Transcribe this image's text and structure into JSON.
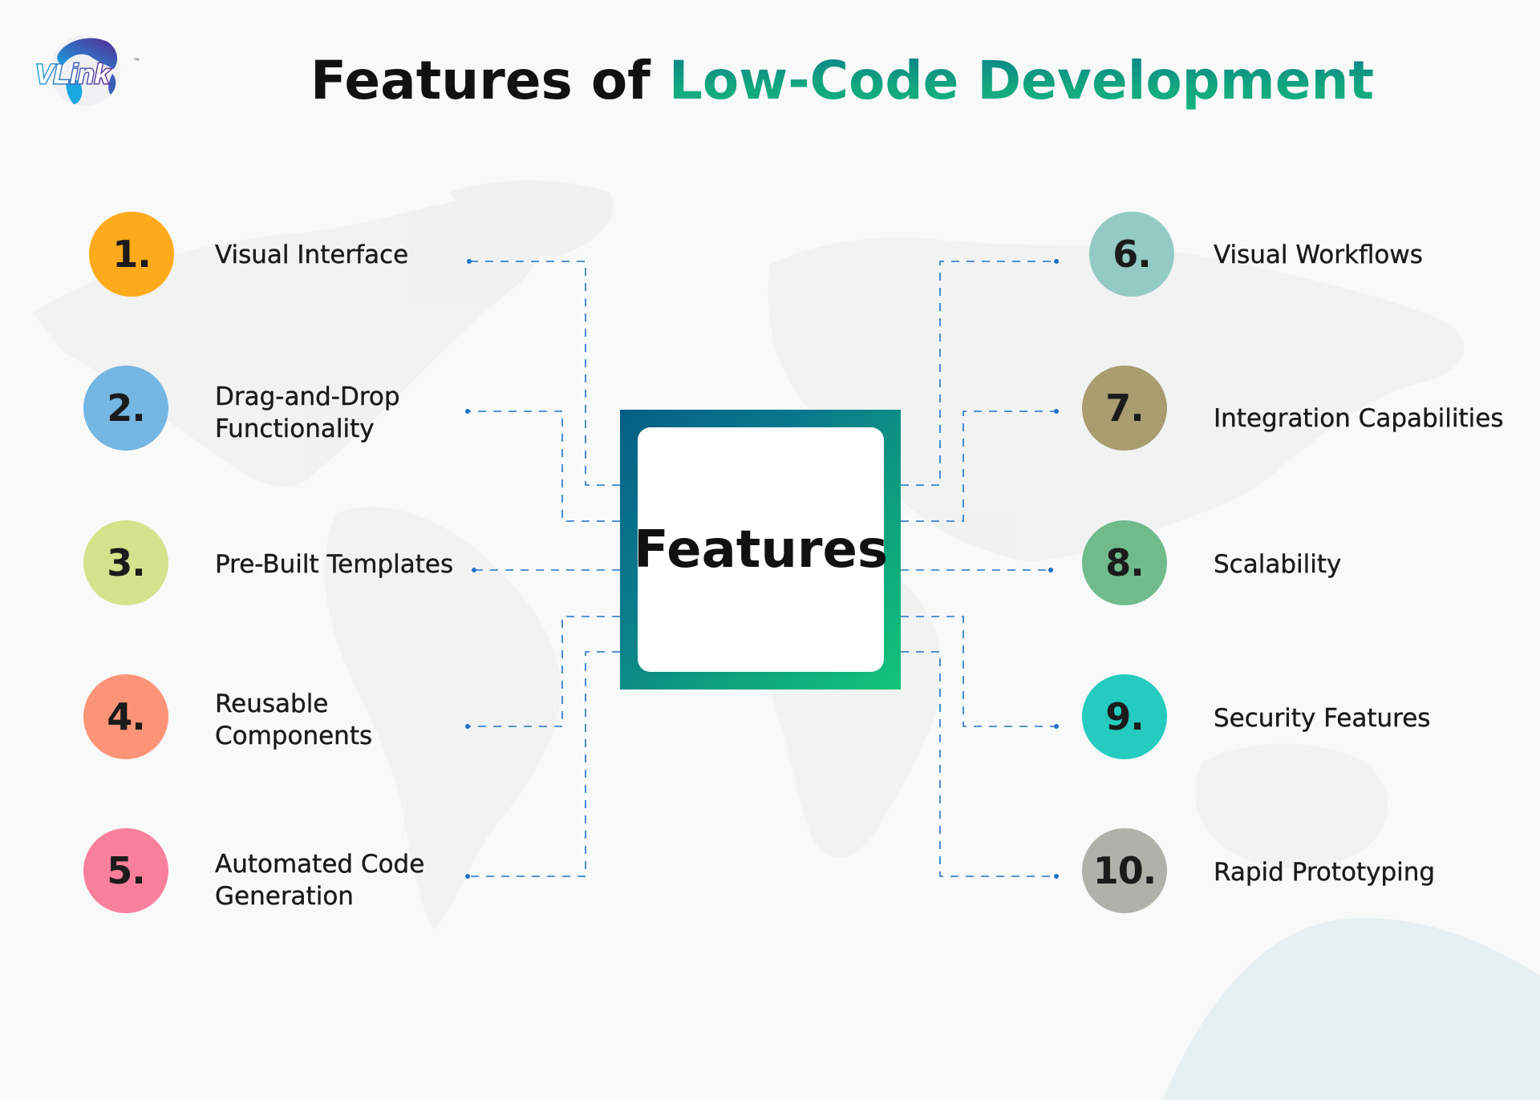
{
  "brand": {
    "logo_text": "VLink",
    "trademark": "™",
    "logo_icon": "globe-icon"
  },
  "header": {
    "title_plain": "Features of ",
    "title_accent": "Low-Code Development",
    "accent_color": "#13a77e"
  },
  "center": {
    "label": "Features",
    "gradient_start": "#055e86",
    "gradient_end": "#13c47a"
  },
  "connector_color": "#1f72c9",
  "features": [
    {
      "number": "1.",
      "label": "Visual Interface",
      "color": "#fdab1b",
      "side": "left"
    },
    {
      "number": "2.",
      "label": "Drag-and-Drop Functionality",
      "line1": "Drag-and-Drop",
      "line2": "Functionality",
      "color": "#75b6e2",
      "side": "left"
    },
    {
      "number": "3.",
      "label": "Pre-Built Templates",
      "color": "#d3e38c",
      "side": "left"
    },
    {
      "number": "4.",
      "label": "Reusable Components",
      "line1": "Reusable",
      "line2": "Components",
      "color": "#fd9478",
      "side": "left"
    },
    {
      "number": "5.",
      "label": "Automated Code Generation",
      "line1": "Automated Code",
      "line2": "Generation",
      "color": "#f9809d",
      "side": "left"
    },
    {
      "number": "6.",
      "label": "Visual Workflows",
      "color": "#93cbc4",
      "side": "right"
    },
    {
      "number": "7.",
      "label": "Integration Capabilities",
      "color": "#a99c6f",
      "side": "right"
    },
    {
      "number": "8.",
      "label": "Scalability",
      "color": "#70ba8c",
      "side": "right"
    },
    {
      "number": "9.",
      "label": "Security Features",
      "color": "#25cbbf",
      "side": "right"
    },
    {
      "number": "10.",
      "label": "Rapid Prototyping",
      "color": "#b0b1aa",
      "side": "right"
    }
  ]
}
